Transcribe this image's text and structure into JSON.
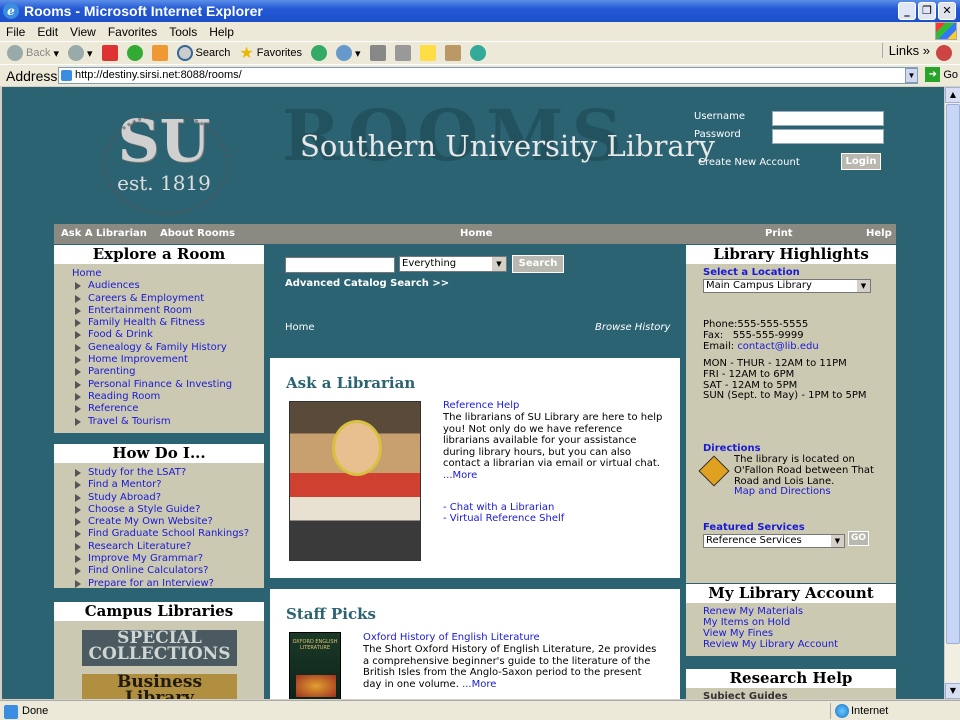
{
  "browser": {
    "title": "Rooms - Microsoft Internet Explorer",
    "menu": [
      "File",
      "Edit",
      "View",
      "Favorites",
      "Tools",
      "Help"
    ],
    "toolbar": {
      "back": "Back",
      "search": "Search",
      "favorites": "Favorites",
      "links": "Links"
    },
    "address_label": "Address",
    "url": "http://destiny.sirsi.net:8088/rooms/",
    "go": "Go",
    "status": "Done",
    "zone": "Internet"
  },
  "header": {
    "logo_letters": "SU",
    "logo_est": "est. 1819",
    "rooms_word": "ROOMS",
    "library_name": "Southern University Library",
    "username_label": "Username",
    "password_label": "Password",
    "create_account": "Create New Account",
    "login_button": "Login"
  },
  "navbar": {
    "ask": "Ask A Librarian",
    "about": "About Rooms",
    "home": "Home",
    "print": "Print",
    "help": "Help"
  },
  "explore": {
    "title": "Explore a Room",
    "home": "Home",
    "items": [
      "Audiences",
      "Careers & Employment",
      "Entertainment Room",
      "Family Health & Fitness",
      "Food & Drink",
      "Genealogy & Family History",
      "Home Improvement",
      "Parenting",
      "Personal Finance & Investing",
      "Reading Room",
      "Reference",
      "Travel & Tourism"
    ]
  },
  "howdoi": {
    "title": "How Do I...",
    "items": [
      "Study for the LSAT?",
      "Find a Mentor?",
      "Study Abroad?",
      "Choose a Style Guide?",
      "Create My Own Website?",
      "Find Graduate School Rankings?",
      "Research Literature?",
      "Improve My Grammar?",
      "Find Online Calculators?",
      "Prepare for an Interview?"
    ]
  },
  "campus": {
    "title": "Campus Libraries",
    "special": "SPECIAL COLLECTIONS",
    "business": "Business Library"
  },
  "search": {
    "scope": "Everything",
    "button": "Search",
    "advanced": "Advanced Catalog Search >>"
  },
  "crumbs": {
    "home": "Home",
    "browse": "Browse History"
  },
  "ask_card": {
    "title": "Ask a Librarian",
    "ref_help": "Reference Help",
    "desc": "The librarians of SU Library are here to help you! Not only do we have reference librarians available for your assistance during library hours, but you can also contact a librarian via email or virtual chat.",
    "more": "...More",
    "chat": "- Chat with a Librarian",
    "vrs": "- Virtual Reference Shelf"
  },
  "staff_card": {
    "title": "Staff Picks",
    "book_title": "Oxford History of English Literature",
    "book_cover": "OXFORD ENGLISH LITERATURE",
    "desc": "The Short Oxford History of English Literature, 2e provides a comprehensive beginner's guide to the literature of the British Isles from the Anglo-Saxon period to the present day in one volume.",
    "more": "...More"
  },
  "highlights": {
    "title": "Library Highlights",
    "select_location": "Select a Location",
    "location": "Main Campus Library",
    "phone": "Phone:555-555-5555",
    "fax": "Fax:   555-555-9999",
    "email_label": "Email:",
    "email": "contact@lib.edu",
    "hours": [
      "MON - THUR - 12AM to 11PM",
      "FRI - 12AM to 6PM",
      "SAT - 12AM to 5PM",
      "SUN (Sept. to May) - 1PM to 5PM"
    ],
    "directions_label": "Directions",
    "directions": "The library is located on O'Fallon Road between That Road and Lois Lane.",
    "map": "Map and Directions",
    "featured_label": "Featured Services",
    "featured": "Reference Services",
    "go": "GO"
  },
  "account": {
    "title": "My Library Account",
    "items": [
      "Renew My Materials",
      "My Items on Hold",
      "View My Fines",
      "Review My Library Account"
    ]
  },
  "research": {
    "title": "Research Help",
    "sub": "Subject Guides"
  },
  "colors": {
    "page_bg": "#2b6373",
    "panel": "#ccc9b3",
    "nav": "#8a8a82",
    "link": "#1a1ad4"
  }
}
